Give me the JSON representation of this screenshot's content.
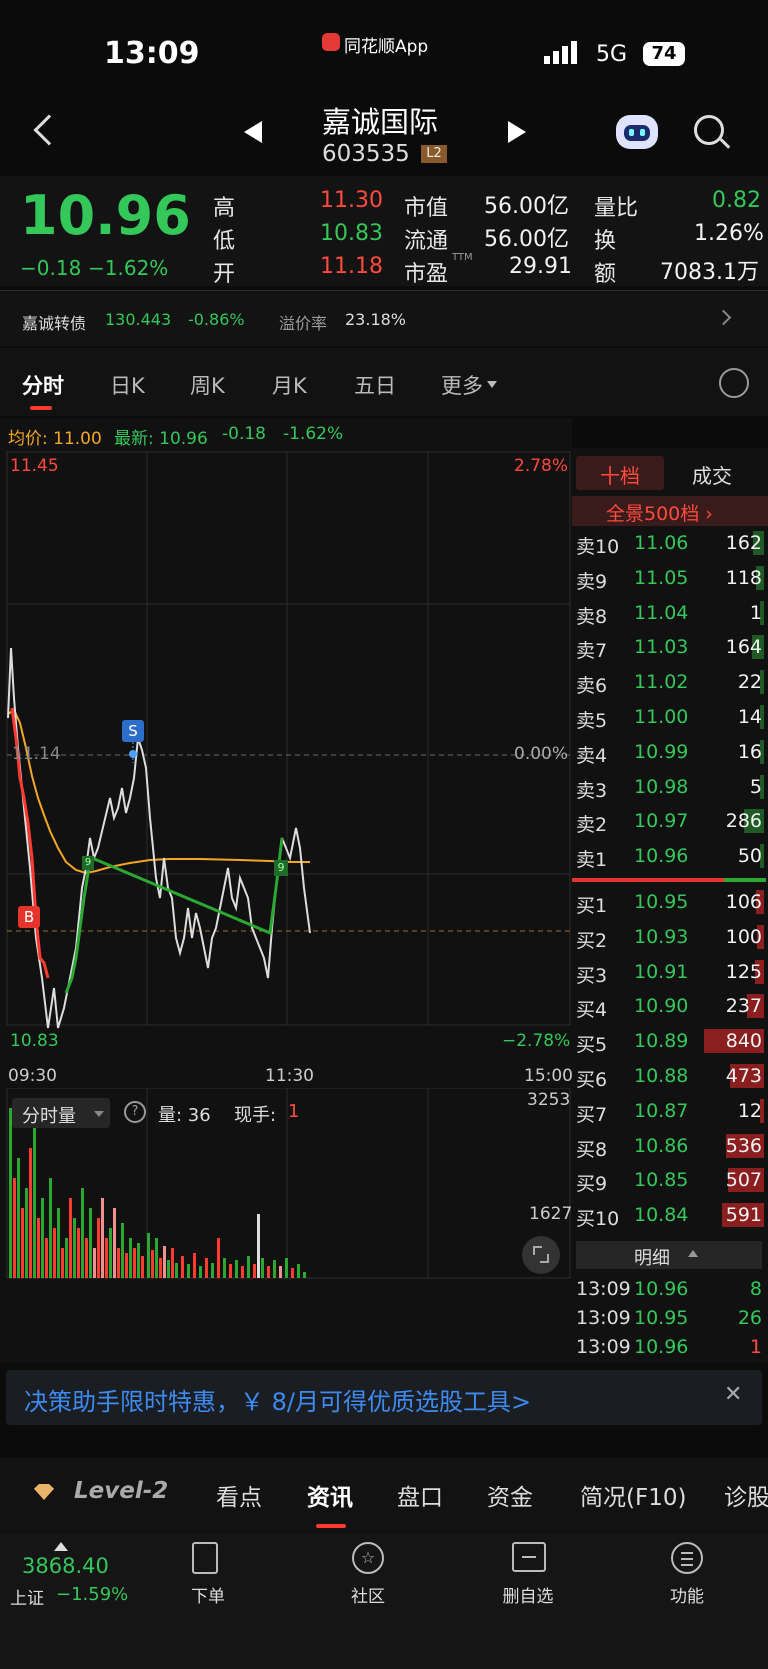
{
  "status": {
    "time": "13:09",
    "app": "同花顺App",
    "network": "5G",
    "battery": "74"
  },
  "nav": {
    "name": "嘉诚国际",
    "code": "603535",
    "level": "L2"
  },
  "quote": {
    "price": "10.96",
    "change": "−0.18",
    "change_pct": "−1.62%",
    "high_label": "高",
    "high": "11.30",
    "low_label": "低",
    "low": "10.83",
    "open_label": "开",
    "open": "11.18",
    "mcap_label": "市值",
    "mcap": "56.00亿",
    "float_label": "流通",
    "float": "56.00亿",
    "pe_label": "市盈",
    "pe_sup": "TTM",
    "pe": "29.91",
    "vr_label": "量比",
    "vr": "0.82",
    "turn_label": "换",
    "turn": "1.26%",
    "amt_label": "额",
    "amt": "7083.1万"
  },
  "bond": {
    "name": "嘉诚转债",
    "price": "130.443",
    "change": "-0.86%",
    "prem_label": "溢价率",
    "prem": "23.18%"
  },
  "tabs": [
    "分时",
    "日K",
    "周K",
    "月K",
    "五日",
    "更多"
  ],
  "chart": {
    "avg_label": "均价: 11.00",
    "latest_label": "最新: 10.96",
    "latest_chg": "-0.18",
    "latest_pct": "-1.62%",
    "top": "11.45",
    "top_pct": "2.78%",
    "mid": "11.14",
    "mid_pct": "0.00%",
    "bottom": "10.83",
    "bottom_pct": "−2.78%",
    "t0": "09:30",
    "t1": "11:30",
    "t2": "15:00",
    "sell_marker": "S",
    "buy_marker": "B",
    "nine_a": "9",
    "nine_b": "9",
    "vol_selector": "分时量",
    "vol_label": "量: 36",
    "hand_label": "现手:",
    "hand": "1",
    "vol_max": "3253",
    "vol_mid": "1627"
  },
  "book": {
    "tab_active": "十档",
    "tab_other": "成交",
    "panorama": "全景500档 ›",
    "sells": [
      {
        "l": "卖10",
        "p": "11.06",
        "v": "162",
        "f": 0.19
      },
      {
        "l": "卖9",
        "p": "11.05",
        "v": "118",
        "f": 0.14
      },
      {
        "l": "卖8",
        "p": "11.04",
        "v": "1",
        "f": 0.01
      },
      {
        "l": "卖7",
        "p": "11.03",
        "v": "164",
        "f": 0.2
      },
      {
        "l": "卖6",
        "p": "11.02",
        "v": "22",
        "f": 0.03
      },
      {
        "l": "卖5",
        "p": "11.00",
        "v": "14",
        "f": 0.02
      },
      {
        "l": "卖4",
        "p": "10.99",
        "v": "16",
        "f": 0.02
      },
      {
        "l": "卖3",
        "p": "10.98",
        "v": "5",
        "f": 0.01
      },
      {
        "l": "卖2",
        "p": "10.97",
        "v": "286",
        "f": 0.34
      },
      {
        "l": "卖1",
        "p": "10.96",
        "v": "50",
        "f": 0.06
      }
    ],
    "buys": [
      {
        "l": "买1",
        "p": "10.95",
        "v": "106",
        "f": 0.13
      },
      {
        "l": "买2",
        "p": "10.93",
        "v": "100",
        "f": 0.12
      },
      {
        "l": "买3",
        "p": "10.91",
        "v": "125",
        "f": 0.15
      },
      {
        "l": "买4",
        "p": "10.90",
        "v": "237",
        "f": 0.28
      },
      {
        "l": "买5",
        "p": "10.89",
        "v": "840",
        "f": 1
      },
      {
        "l": "买6",
        "p": "10.88",
        "v": "473",
        "f": 0.56
      },
      {
        "l": "买7",
        "p": "10.87",
        "v": "12",
        "f": 0.02
      },
      {
        "l": "买8",
        "p": "10.86",
        "v": "536",
        "f": 0.64
      },
      {
        "l": "买9",
        "p": "10.85",
        "v": "507",
        "f": 0.6
      },
      {
        "l": "买10",
        "p": "10.84",
        "v": "591",
        "f": 0.7
      }
    ],
    "detail_label": "明细",
    "trades": [
      {
        "t": "13:09",
        "p": "10.96",
        "v": "8"
      },
      {
        "t": "13:09",
        "p": "10.95",
        "v": "26"
      },
      {
        "t": "13:09",
        "p": "10.96",
        "v": "1"
      }
    ]
  },
  "banner": {
    "text": "决策助手限时特惠，￥ 8/月可得优质选股工具>"
  },
  "bottom_tabs": [
    "Level-2",
    "看点",
    "资讯",
    "盘口",
    "资金",
    "简况(F10)",
    "诊股"
  ],
  "footer": {
    "index_value": "3868.40",
    "index_name": "上证",
    "index_pct": "−1.59%",
    "items": [
      "下单",
      "社区",
      "删自选",
      "功能"
    ]
  }
}
